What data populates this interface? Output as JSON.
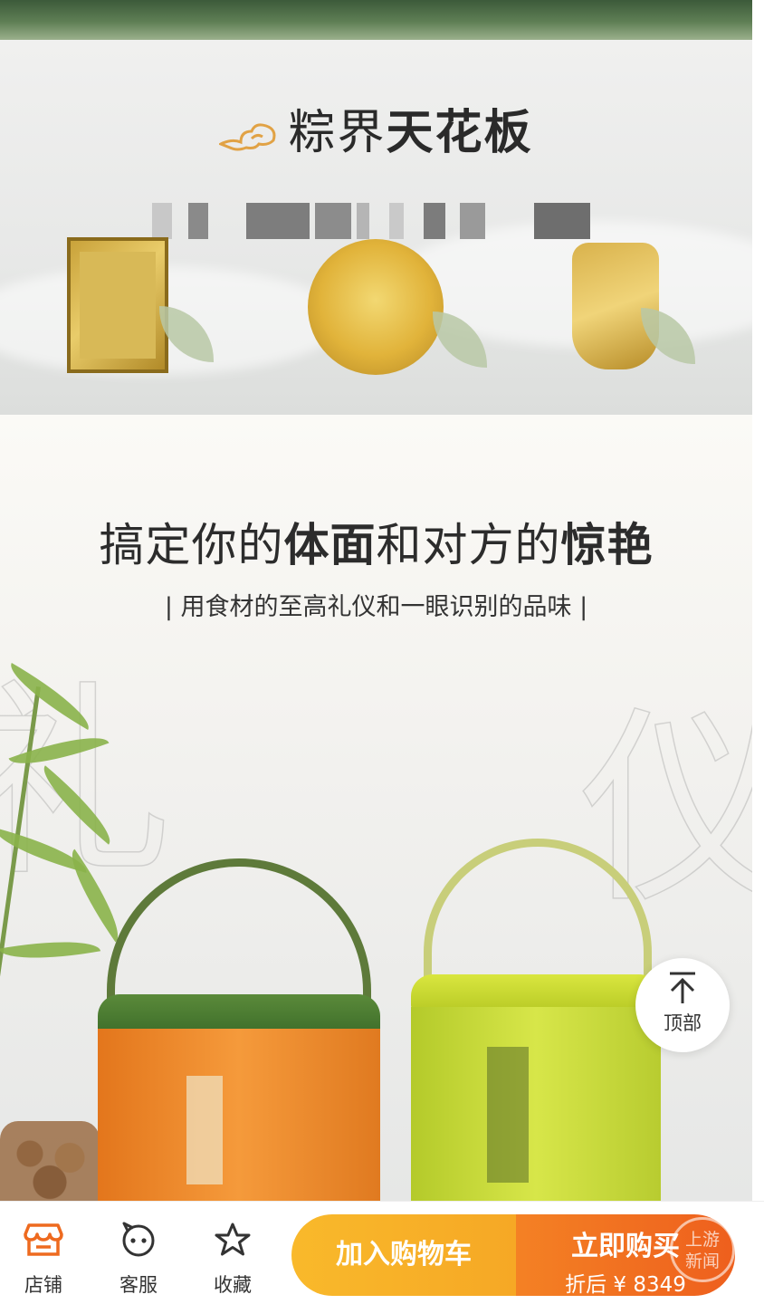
{
  "section1": {
    "title_light": "粽界",
    "title_bold": "天花板"
  },
  "section2": {
    "headline_part1": "搞定你的",
    "headline_bold1": "体面",
    "headline_part2": "和对方的",
    "headline_bold2": "惊艳",
    "subline": "| 用食材的至高礼仪和一眼识别的品味 |",
    "ghost_char_left": "礼",
    "ghost_char_right": "仪"
  },
  "back_to_top": {
    "label": "顶部",
    "icon": "arrow-up-icon"
  },
  "bottom_bar": {
    "tabs": [
      {
        "label": "店铺",
        "icon": "store-icon"
      },
      {
        "label": "客服",
        "icon": "customer-service-icon"
      },
      {
        "label": "收藏",
        "icon": "star-icon"
      }
    ],
    "add_to_cart": "加入购物车",
    "buy_now": "立即购买",
    "price_after_discount": "折后 ¥ 8349",
    "accent_orange": "#f6a825",
    "accent_red": "#ee5f1d"
  },
  "watermark": {
    "line1": "上游",
    "line2": "新闻"
  }
}
